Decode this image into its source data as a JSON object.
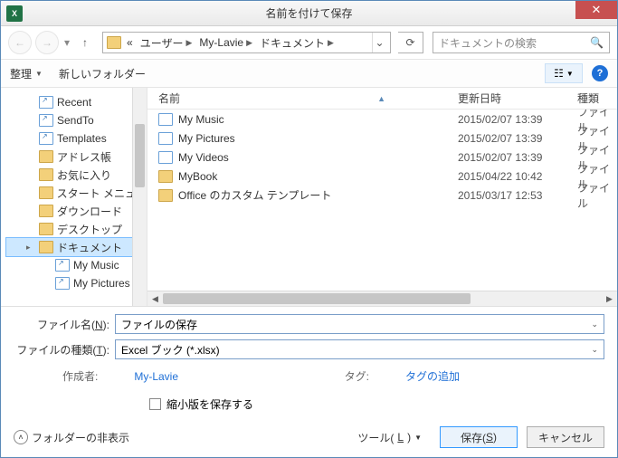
{
  "title": "名前を付けて保存",
  "app_icon_text": "X",
  "breadcrumb": {
    "prefix": "«",
    "items": [
      "ユーザー",
      "My-Lavie",
      "ドキュメント"
    ]
  },
  "search_placeholder": "ドキュメントの検索",
  "toolbar": {
    "organize": "整理",
    "new_folder": "新しいフォルダー"
  },
  "tree": [
    {
      "label": "Recent",
      "icon": "link",
      "indent": true
    },
    {
      "label": "SendTo",
      "icon": "link",
      "indent": true
    },
    {
      "label": "Templates",
      "icon": "link",
      "indent": true
    },
    {
      "label": "アドレス帳",
      "icon": "folder",
      "indent": true
    },
    {
      "label": "お気に入り",
      "icon": "folder",
      "indent": true
    },
    {
      "label": "スタート メニュー",
      "icon": "folder",
      "indent": true
    },
    {
      "label": "ダウンロード",
      "icon": "folder",
      "indent": true
    },
    {
      "label": "デスクトップ",
      "icon": "folder",
      "indent": true
    },
    {
      "label": "ドキュメント",
      "icon": "folder",
      "indent": true,
      "selected": true,
      "expandable": true
    },
    {
      "label": "My Music",
      "icon": "link",
      "indent": true,
      "deep": true
    },
    {
      "label": "My Pictures",
      "icon": "link",
      "indent": true,
      "deep": true
    }
  ],
  "columns": {
    "name": "名前",
    "date": "更新日時",
    "type": "種類"
  },
  "files": [
    {
      "name": "My Music",
      "date": "2015/02/07 13:39",
      "type": "ファイル",
      "icon": "link"
    },
    {
      "name": "My Pictures",
      "date": "2015/02/07 13:39",
      "type": "ファイル",
      "icon": "link"
    },
    {
      "name": "My Videos",
      "date": "2015/02/07 13:39",
      "type": "ファイル",
      "icon": "link"
    },
    {
      "name": "MyBook",
      "date": "2015/04/22 10:42",
      "type": "ファイル",
      "icon": "folder"
    },
    {
      "name": "Office のカスタム テンプレート",
      "date": "2015/03/17 12:53",
      "type": "ファイル",
      "icon": "folder"
    }
  ],
  "form": {
    "filename_label_pre": "ファイル名(",
    "filename_label_key": "N",
    "filename_label_post": "):",
    "filename_value": "ファイルの保存",
    "filetype_label_pre": "ファイルの種類(",
    "filetype_label_key": "T",
    "filetype_label_post": "):",
    "filetype_value": "Excel ブック (*.xlsx)",
    "author_label": "作成者:",
    "author_value": "My-Lavie",
    "tag_label": "タグ:",
    "tag_value": "タグの追加",
    "thumbnail_check": "縮小版を保存する"
  },
  "bottom": {
    "hide_folders": "フォルダーの非表示",
    "tools_pre": "ツール(",
    "tools_key": "L",
    "tools_post": ")",
    "save_pre": "保存(",
    "save_key": "S",
    "save_post": ")",
    "cancel": "キャンセル"
  }
}
